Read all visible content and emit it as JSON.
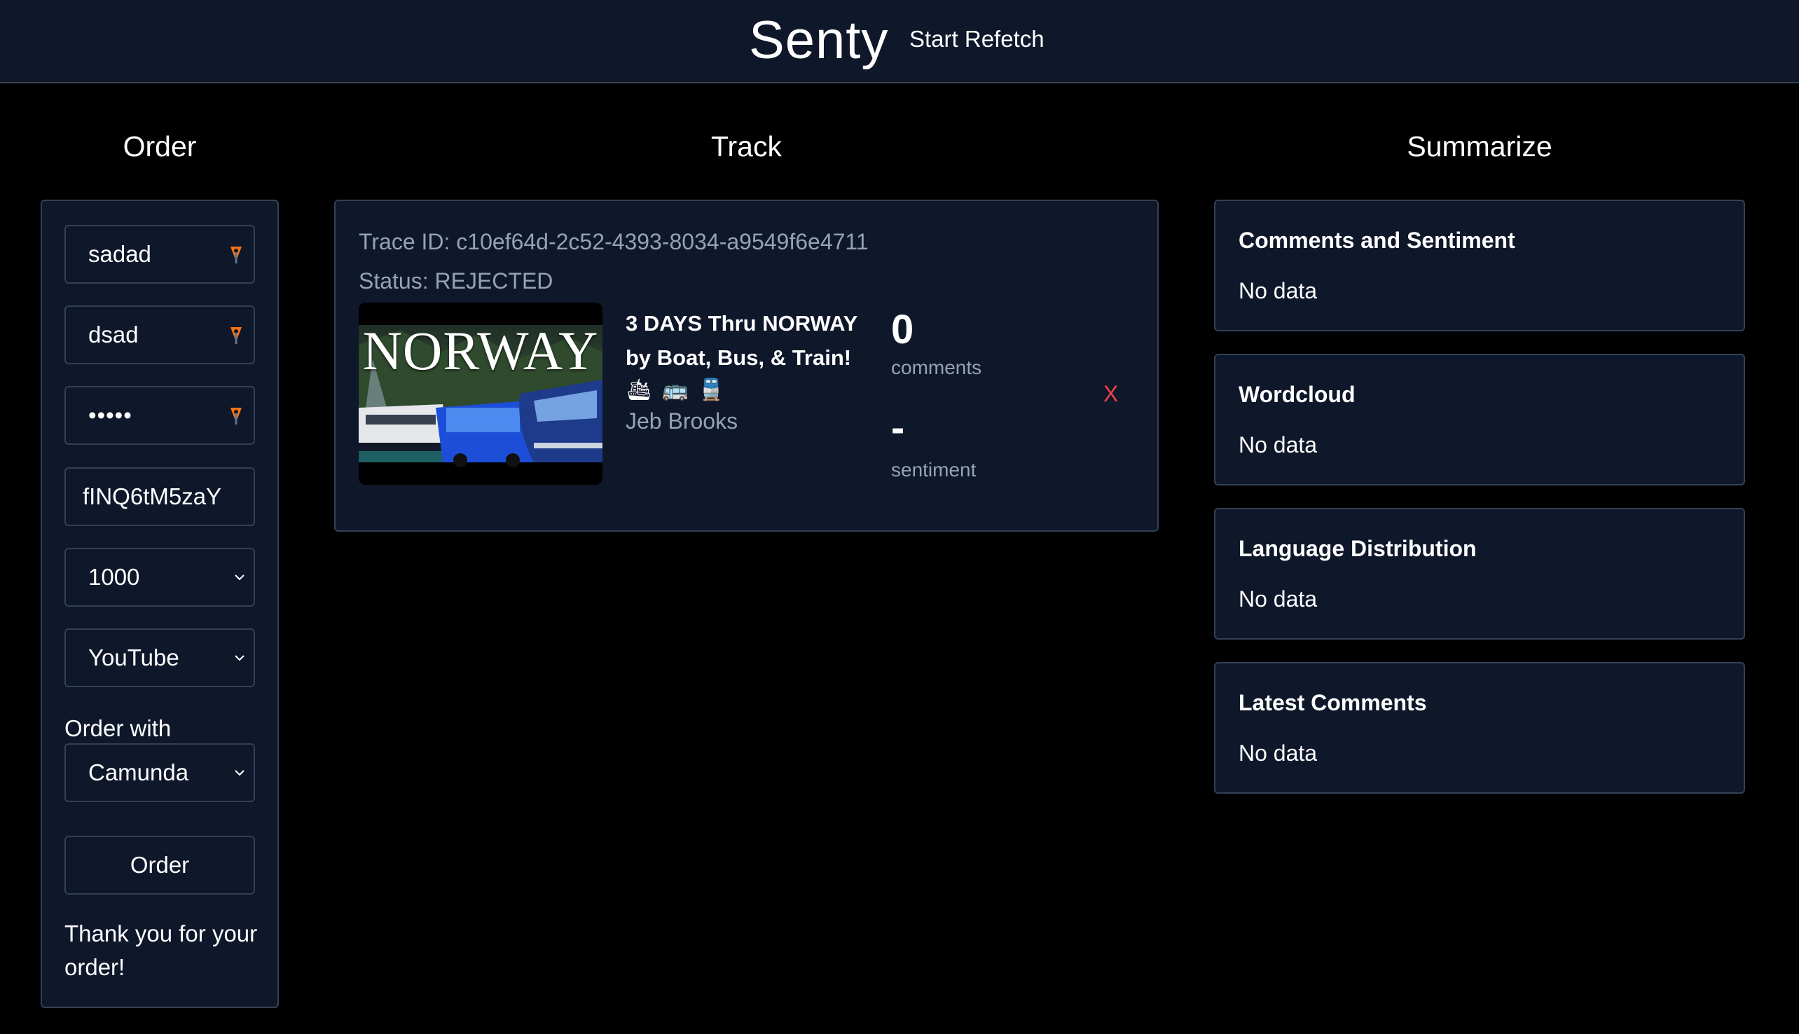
{
  "header": {
    "brand": "Senty",
    "refetch_label": "Start Refetch"
  },
  "columns": {
    "order": "Order",
    "track": "Track",
    "summarize": "Summarize"
  },
  "order_form": {
    "field_1": "sadad",
    "field_2": "dsad",
    "field_3_masked": "•••••",
    "video_id": "fINQ6tM5zaY",
    "amount": "1000",
    "platform": "YouTube",
    "order_with_label": "Order with",
    "engine": "Camunda",
    "submit_label": "Order",
    "message": "Thank you for your order!"
  },
  "track": {
    "trace_id": "Trace ID: c10ef64d-2c52-4393-8034-a9549f6e4711",
    "status": "Status: REJECTED",
    "thumbnail_text": "NORWAY",
    "video_title": "3 DAYS Thru NORWAY by Boat, Bus, & Train!",
    "video_emojis": "🛳🚌🚆",
    "channel": "Jeb Brooks",
    "comments_value": "0",
    "comments_label": "comments",
    "sentiment_value": "-",
    "sentiment_label": "sentiment",
    "remove_label": "X"
  },
  "summarize": {
    "cards": [
      {
        "title": "Comments and Sentiment",
        "body": "No data"
      },
      {
        "title": "Wordcloud",
        "body": "No data"
      },
      {
        "title": "Language Distribution",
        "body": "No data"
      },
      {
        "title": "Latest Comments",
        "body": "No data"
      }
    ]
  },
  "colors": {
    "background": "#000000",
    "panel": "#0f172a",
    "border": "#334155",
    "muted_text": "#94a3b8",
    "danger": "#ef4444",
    "password_icon": "#f97316"
  },
  "icons": {
    "password_manager": "password-manager-icon",
    "dropdown": "chevron-down-icon"
  }
}
